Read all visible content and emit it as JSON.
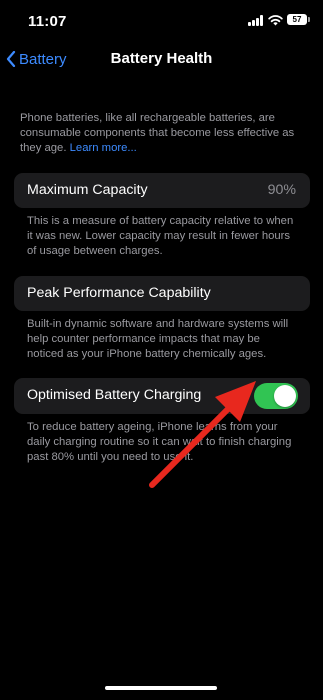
{
  "status_bar": {
    "time": "11:07",
    "battery_level": "57"
  },
  "nav": {
    "back_label": "Battery",
    "title": "Battery Health"
  },
  "intro": {
    "text": "Phone batteries, like all rechargeable batteries, are consumable components that become less effective as they age. ",
    "link": "Learn more..."
  },
  "maximum_capacity": {
    "label": "Maximum Capacity",
    "value": "90%",
    "footnote": "This is a measure of battery capacity relative to when it was new. Lower capacity may result in fewer hours of usage between charges."
  },
  "peak_performance": {
    "label": "Peak Performance Capability",
    "footnote": "Built-in dynamic software and hardware systems will help counter performance impacts that may be noticed as your iPhone battery chemically ages."
  },
  "optimised_charging": {
    "label": "Optimised Battery Charging",
    "enabled": true,
    "footnote": "To reduce battery ageing, iPhone learns from your daily charging routine so it can wait to finish charging past 80% until you need to use it."
  },
  "colors": {
    "accent": "#3d8bff",
    "toggle_on": "#31c453",
    "card_bg": "#1c1c1e",
    "annotation_arrow": "#e8281e"
  }
}
